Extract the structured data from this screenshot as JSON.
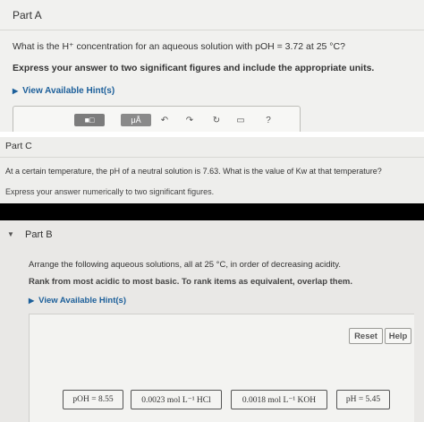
{
  "part_a": {
    "title": "Part A",
    "question": "What is the H⁺ concentration for an aqueous solution with pOH = 3.72 at 25 °C?",
    "instruction": "Express your answer to two significant figures and include the appropriate units.",
    "hint": "View Available Hint(s)",
    "toolbar": {
      "templates": "■□",
      "symbols": "μÅ",
      "undo": "↶",
      "redo": "↷",
      "reset": "↻",
      "keyboard": "▭",
      "help": "?"
    }
  },
  "part_c": {
    "title": "Part C",
    "question": "At a certain temperature, the pH of a neutral solution is 7.63. What is the value of Kᵥᵥ at that temperature?",
    "question_display": "At a certain temperature, the pH of a neutral solution is 7.63. What is the value of Kw at that temperature?",
    "instruction": "Express your answer numerically to two significant figures."
  },
  "part_b": {
    "title": "Part B",
    "question": "Arrange the following aqueous solutions, all at 25 °C, in order of decreasing acidity.",
    "instruction": "Rank from most acidic to most basic. To rank items as equivalent, overlap them.",
    "hint": "View Available Hint(s)",
    "reset_label": "Reset",
    "help_label": "Help",
    "chips": [
      "pOH = 8.55",
      "0.0023 mol L⁻¹ HCl",
      "0.0018 mol L⁻¹ KOH",
      "pH = 5.45"
    ]
  }
}
